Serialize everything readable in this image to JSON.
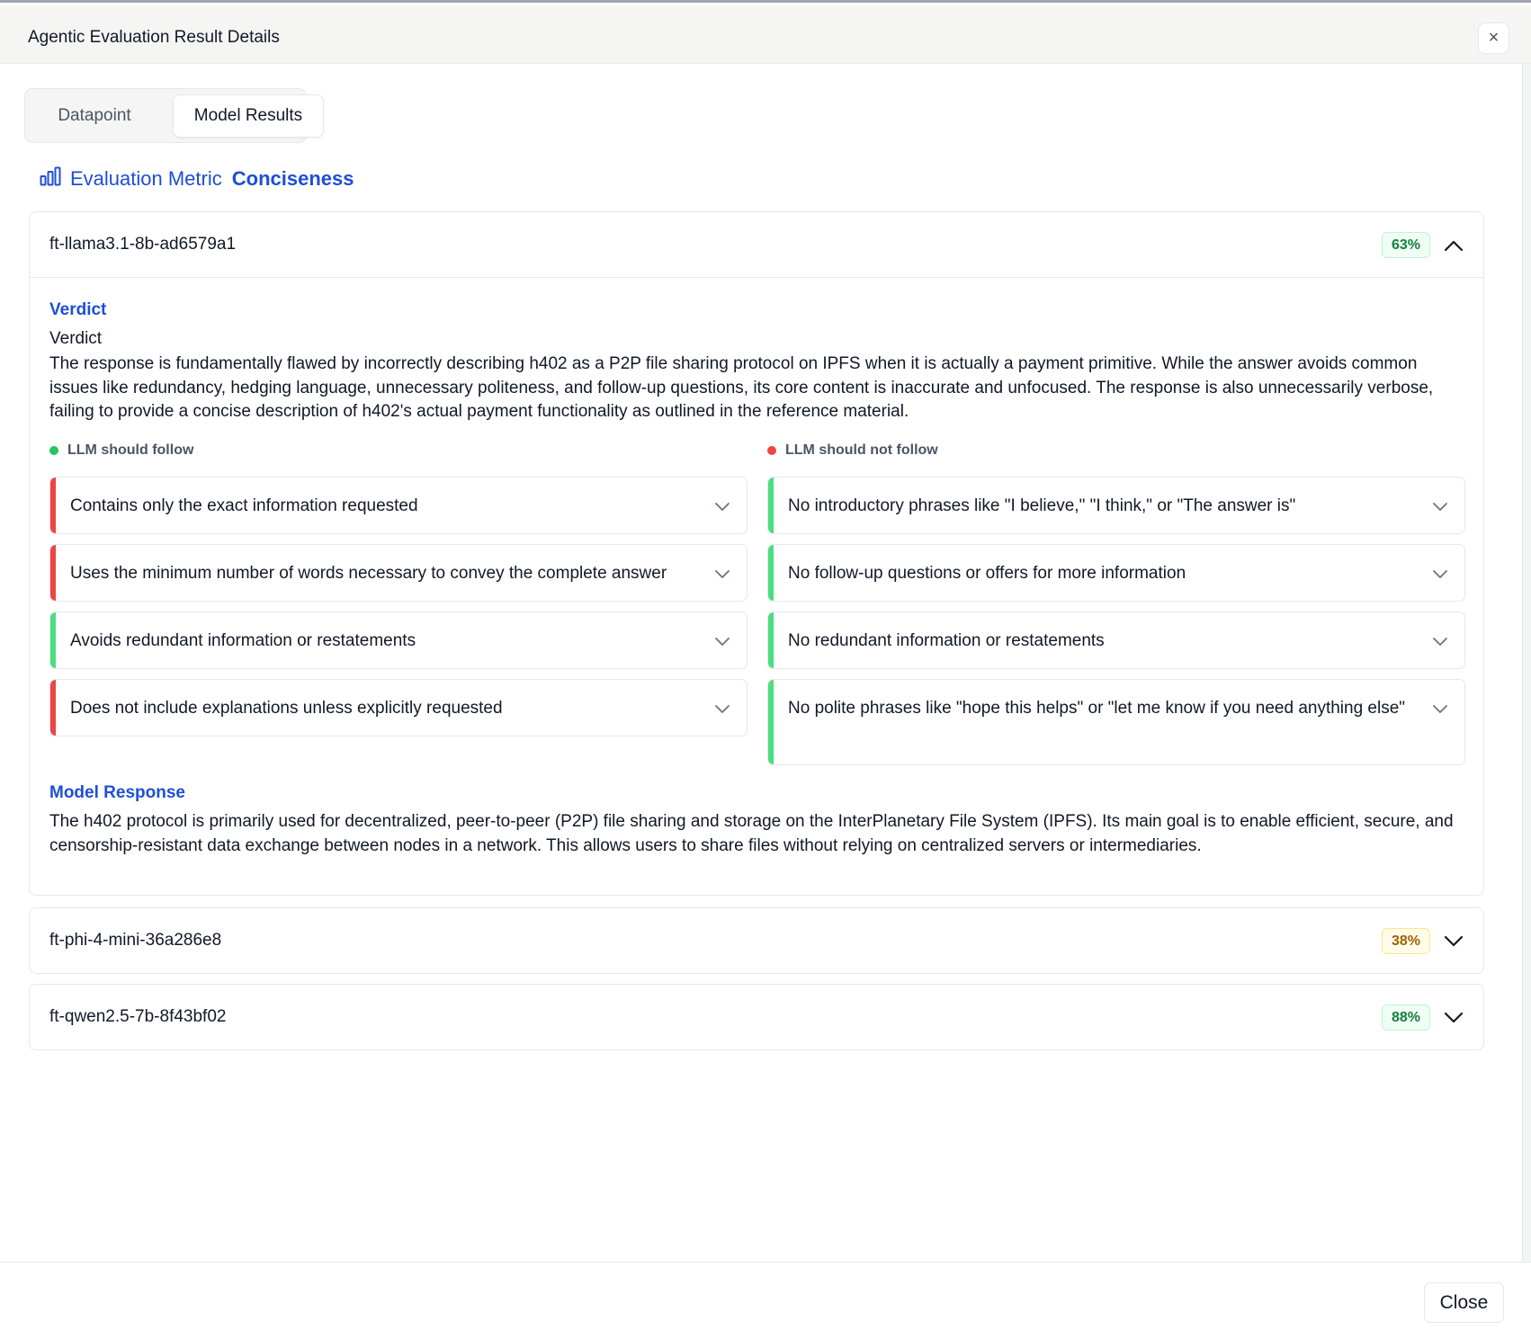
{
  "dialog": {
    "title": "Agentic Evaluation Result Details",
    "close_icon": "x-icon",
    "footer_close_label": "Close"
  },
  "tabs": [
    {
      "label": "Datapoint",
      "active": false
    },
    {
      "label": "Model Results",
      "active": true
    }
  ],
  "metric": {
    "icon": "bar-chart-icon",
    "label": "Evaluation Metric",
    "value": "Conciseness"
  },
  "colors": {
    "accent": "#1d4ed8",
    "pass": "#4ade80",
    "fail": "#ef4444",
    "badge_green": "#15803d",
    "badge_yellow": "#a16207"
  },
  "models": [
    {
      "name": "ft-llama3.1-8b-ad6579a1",
      "score": "63%",
      "score_level": "green",
      "expanded": true,
      "verdict_heading": "Verdict",
      "verdict_sub": "Verdict",
      "verdict_text": "The response is fundamentally flawed by incorrectly describing h402 as a P2P file sharing protocol on IPFS when it is actually a payment primitive. While the answer avoids common issues like redundancy, hedging language, unnecessary politeness, and follow-up questions, its core content is inaccurate and unfocused. The response is also unnecessarily verbose, failing to provide a concise description of h402's actual payment functionality as outlined in the reference material.",
      "should_follow_label": "LLM should follow",
      "should_not_follow_label": "LLM should not follow",
      "should_follow": [
        {
          "text": "Contains only the exact information requested",
          "status": "fail"
        },
        {
          "text": "Uses the minimum number of words necessary to convey the complete answer",
          "status": "fail"
        },
        {
          "text": "Avoids redundant information or restatements",
          "status": "pass"
        },
        {
          "text": "Does not include explanations unless explicitly requested",
          "status": "fail"
        }
      ],
      "should_not_follow": [
        {
          "text": "No introductory phrases like \"I believe,\" \"I think,\" or \"The answer is\"",
          "status": "pass"
        },
        {
          "text": "No follow-up questions or offers for more information",
          "status": "pass"
        },
        {
          "text": "No redundant information or restatements",
          "status": "pass"
        },
        {
          "text": "No polite phrases like \"hope this helps\" or \"let me know if you need anything else\"",
          "status": "pass"
        }
      ],
      "response_heading": "Model Response",
      "response_text": "The h402 protocol is primarily used for decentralized, peer-to-peer (P2P) file sharing and storage on the InterPlanetary File System (IPFS). Its main goal is to enable efficient, secure, and censorship-resistant data exchange between nodes in a network. This allows users to share files without relying on centralized servers or intermediaries."
    },
    {
      "name": "ft-phi-4-mini-36a286e8",
      "score": "38%",
      "score_level": "yellow",
      "expanded": false
    },
    {
      "name": "ft-qwen2.5-7b-8f43bf02",
      "score": "88%",
      "score_level": "green",
      "expanded": false
    }
  ]
}
